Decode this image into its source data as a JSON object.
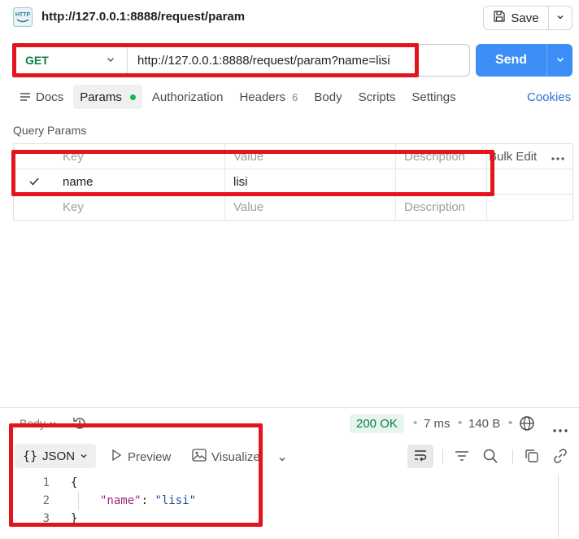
{
  "header": {
    "title": "http://127.0.0.1:8888/request/param",
    "save_label": "Save"
  },
  "request": {
    "method": "GET",
    "url": "http://127.0.0.1:8888/request/param?name=lisi",
    "send_label": "Send"
  },
  "tabs": {
    "docs": "Docs",
    "params": "Params",
    "authorization": "Authorization",
    "headers": "Headers",
    "headers_count": "6",
    "body": "Body",
    "scripts": "Scripts",
    "settings": "Settings",
    "cookies": "Cookies"
  },
  "query_params": {
    "label": "Query Params",
    "columns": {
      "key": "Key",
      "value": "Value",
      "description": "Description",
      "bulk_edit": "Bulk Edit"
    },
    "rows": [
      {
        "key": "name",
        "value": "lisi",
        "description": "",
        "checked": true
      }
    ],
    "placeholder": {
      "key": "Key",
      "value": "Value",
      "description": "Description"
    }
  },
  "response": {
    "body_label": "Body",
    "status": "200 OK",
    "time": "7 ms",
    "size": "140 B",
    "format": "JSON",
    "preview_label": "Preview",
    "visualize_label": "Visualize",
    "lines": [
      {
        "num": "1",
        "text": "{"
      },
      {
        "num": "2",
        "key": "\"name\"",
        "colon": ": ",
        "value": "\"lisi\""
      },
      {
        "num": "3",
        "text": "}"
      }
    ]
  },
  "colors": {
    "accent": "#3d8ef7",
    "method_get": "#0b7d45",
    "status_ok_bg": "#e6f6ec",
    "highlight": "#e3141e"
  }
}
